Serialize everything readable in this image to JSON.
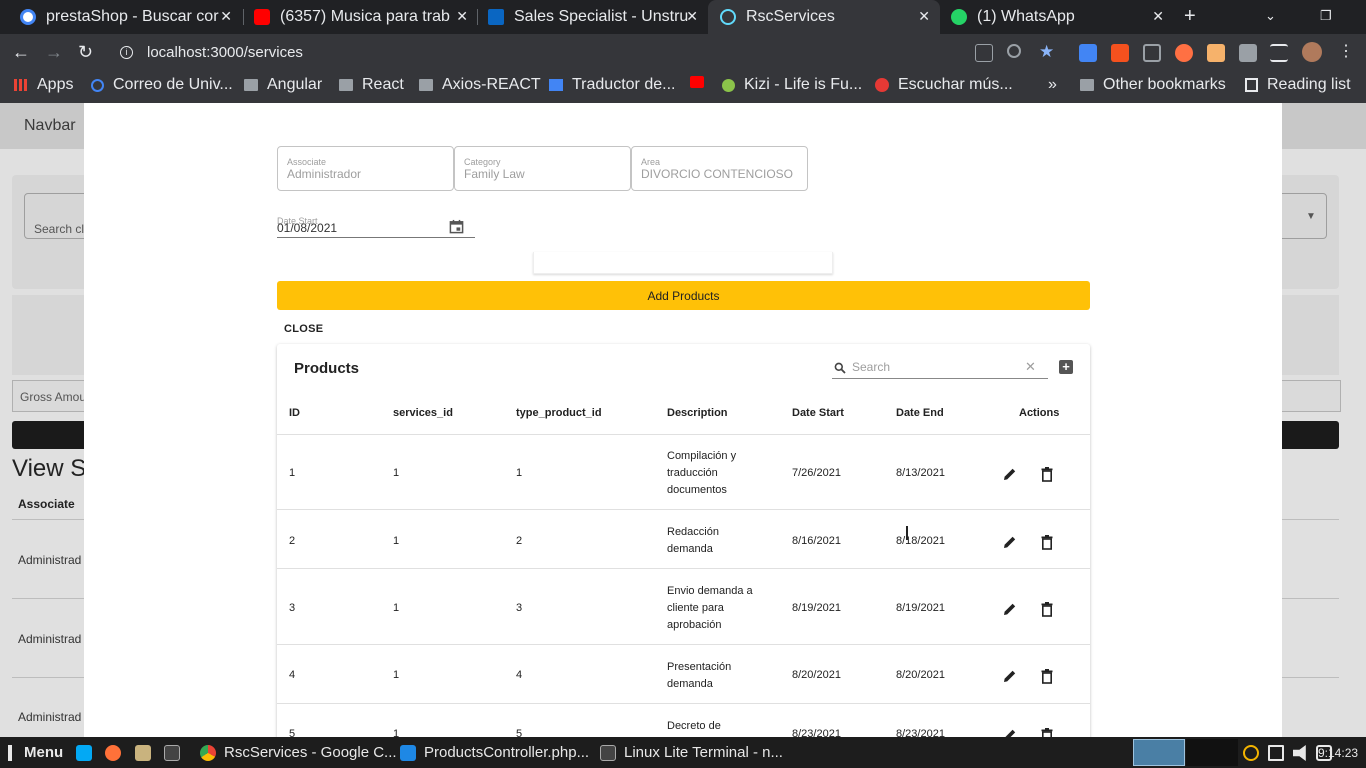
{
  "browser": {
    "tabs": [
      {
        "title": "prestaShop - Buscar cor",
        "icon": "google-icon",
        "color": "#4285f4"
      },
      {
        "title": "(6357) Musica para trab",
        "icon": "youtube-icon",
        "color": "#ff0000"
      },
      {
        "title": "Sales Specialist - Unstru",
        "icon": "linkedin-icon",
        "color": "#0a66c2"
      },
      {
        "title": "RscServices",
        "icon": "react-icon",
        "color": "#61dafb"
      },
      {
        "title": "(1) WhatsApp",
        "icon": "whatsapp-icon",
        "color": "#25d366"
      }
    ],
    "address": "localhost:3000/services",
    "bookmarks": [
      {
        "label": "Apps",
        "icon": "apps-icon"
      },
      {
        "label": "Correo de Univ...",
        "icon": "google-icon"
      },
      {
        "label": "Angular",
        "icon": "folder-icon"
      },
      {
        "label": "React",
        "icon": "folder-icon"
      },
      {
        "label": "Axios-REACT",
        "icon": "folder-icon"
      },
      {
        "label": "Traductor de...",
        "icon": "translate-icon"
      },
      {
        "label": "",
        "icon": "youtube-icon"
      },
      {
        "label": "Kizi - Life is Fu...",
        "icon": "kizi-icon"
      },
      {
        "label": "Escuchar mús...",
        "icon": "music-icon"
      }
    ],
    "other_bookmarks": "Other bookmarks",
    "reading_list": "Reading list",
    "more": "»"
  },
  "background": {
    "navbar": "Navbar",
    "search_placeholder": "Search cl",
    "gross_amount": "Gross Amou",
    "view_title": "View S",
    "col_associate": "Associate",
    "rows": [
      "Administrad",
      "Administrad",
      "Administrad"
    ]
  },
  "form": {
    "associate_label": "Associate",
    "associate_value": "Administrador",
    "category_label": "Category",
    "category_value": "Family Law",
    "area_label": "Area",
    "area_value": "DIVORCIO CONTENCIOSO",
    "date_start_label": "Date Start",
    "date_start_value": "01/08/2021",
    "add_products": "Add Products",
    "close": "CLOSE"
  },
  "products": {
    "title": "Products",
    "search_placeholder": "Search",
    "columns": [
      "ID",
      "services_id",
      "type_product_id",
      "Description",
      "Date Start",
      "Date End",
      "Actions"
    ],
    "rows": [
      {
        "id": "1",
        "services_id": "1",
        "type_product_id": "1",
        "description": "Compilación y traducción documentos",
        "date_start": "7/26/2021",
        "date_end": "8/13/2021"
      },
      {
        "id": "2",
        "services_id": "1",
        "type_product_id": "2",
        "description": "Redacción demanda",
        "date_start": "8/16/2021",
        "date_end": "8/18/2021"
      },
      {
        "id": "3",
        "services_id": "1",
        "type_product_id": "3",
        "description": "Envio demanda a cliente para aprobación",
        "date_start": "8/19/2021",
        "date_end": "8/19/2021"
      },
      {
        "id": "4",
        "services_id": "1",
        "type_product_id": "4",
        "description": "Presentación demanda",
        "date_start": "8/20/2021",
        "date_end": "8/20/2021"
      },
      {
        "id": "5",
        "services_id": "1",
        "type_product_id": "5",
        "description": "Decreto de",
        "date_start": "8/23/2021",
        "date_end": "8/23/2021"
      }
    ]
  },
  "taskbar": {
    "menu": "Menu",
    "items": [
      "RscServices - Google C...",
      "ProductsController.php...",
      "Linux Lite Terminal - n..."
    ],
    "time": "9:14:23"
  }
}
